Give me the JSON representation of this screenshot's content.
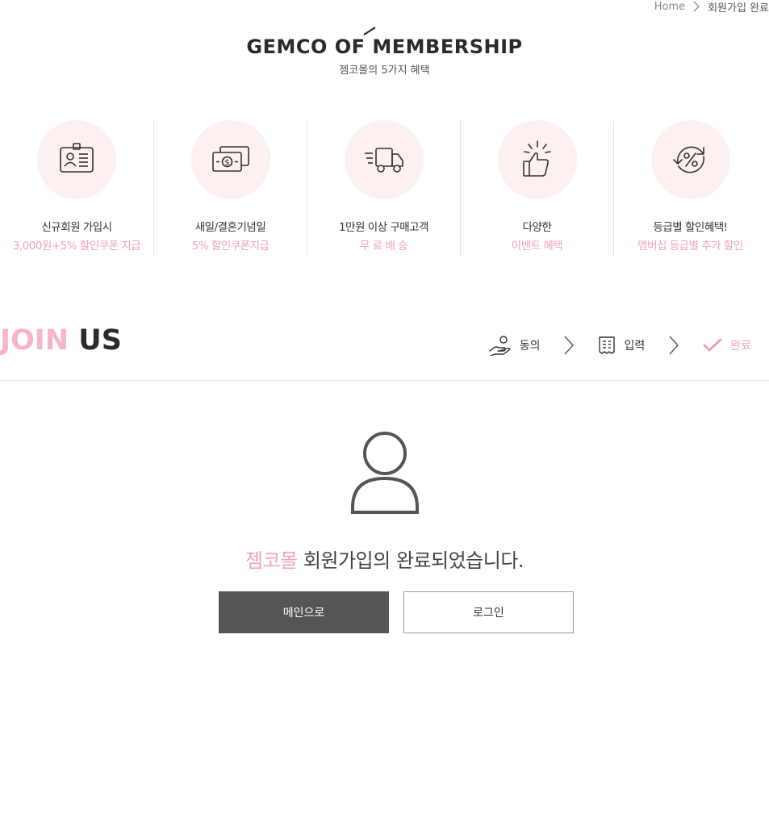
{
  "breadcrumb": {
    "home": "Home",
    "current": "회원가입 완료"
  },
  "hero": {
    "title": "GEMCO OF MEMBERSHIP",
    "subtitle": "젬코몰의 5가지 혜택"
  },
  "benefits": [
    {
      "icon": "id-card-icon",
      "title": "신규회원 가입시",
      "desc": "3,000원+5% 할인쿠폰 지급"
    },
    {
      "icon": "money-icon",
      "title": "새일/결혼기념일",
      "desc": "5% 할인쿠폰지급"
    },
    {
      "icon": "truck-icon",
      "title": "1만원 이상 구매고객",
      "desc": "무 료 배 송"
    },
    {
      "icon": "thumbs-up-icon",
      "title": "다양한",
      "desc": "이벤트 혜택"
    },
    {
      "icon": "percent-icon",
      "title": "등급별 할인혜택!",
      "desc": "멤버십 등급별 추가 할인"
    }
  ],
  "join": {
    "title_pink": "JOIN",
    "title_dark": "US",
    "steps": [
      {
        "icon": "hand-agree-icon",
        "label": "동의"
      },
      {
        "icon": "form-icon",
        "label": "입력"
      },
      {
        "icon": "check-icon",
        "label": "완료",
        "active": true
      }
    ]
  },
  "complete": {
    "icon": "user-icon",
    "brand": "젬코몰",
    "message": " 회원가입의 완료되었습니다."
  },
  "buttons": {
    "main": "메인으로",
    "login": "로그인"
  },
  "colors": {
    "accent_pink": "#f2a2b8",
    "circle_bg": "#fcf0f0",
    "dark_button": "#555555"
  }
}
